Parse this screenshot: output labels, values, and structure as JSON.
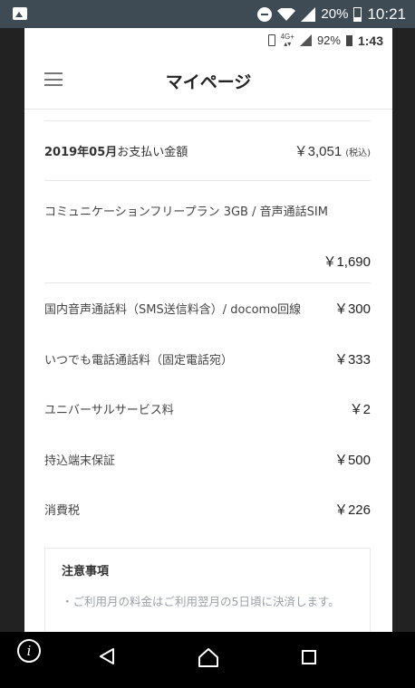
{
  "status_bar": {
    "battery_percent": "20%",
    "time": "10:21"
  },
  "inner_status": {
    "network": "4G+",
    "battery_percent": "92%",
    "time": "1:43"
  },
  "header": {
    "title": "マイページ"
  },
  "summary": {
    "month": "2019年05月",
    "label": "お支払い金額",
    "amount": "￥3,051",
    "tax_note": "(税込)"
  },
  "plan": {
    "name": "コミュニケーションフリープラン 3GB / 音声通話SIM",
    "price": "￥1,690"
  },
  "fees": [
    {
      "label": "国内音声通話料（SMS送信料含）/ docomo回線",
      "amount": "￥300"
    },
    {
      "label": "いつでも電話通話料（固定電話宛）",
      "amount": "￥333"
    },
    {
      "label": "ユニバーサルサービス料",
      "amount": "￥2"
    },
    {
      "label": "持込端末保証",
      "amount": "￥500"
    },
    {
      "label": "消費税",
      "amount": "￥226"
    }
  ],
  "notice": {
    "title": "注意事項",
    "text": "・ご利用月の料金はご利用翌月の5日頃に決済します。"
  },
  "nav": {
    "info_glyph": "i"
  }
}
